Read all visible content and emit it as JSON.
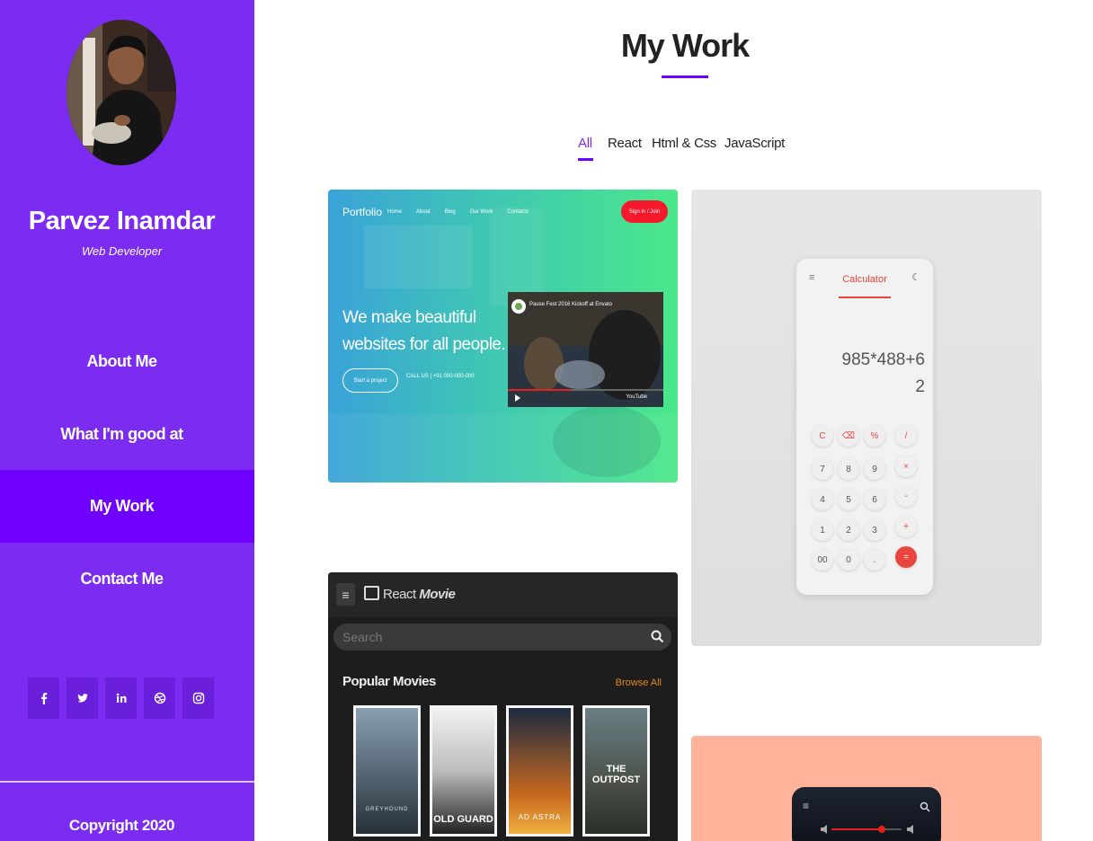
{
  "sidebar": {
    "name": "Parvez Inamdar",
    "role": "Web Developer",
    "nav": [
      {
        "label": "About Me",
        "active": false
      },
      {
        "label": "What I'm good at",
        "active": false
      },
      {
        "label": "My Work",
        "active": true
      },
      {
        "label": "Contact Me",
        "active": false
      }
    ],
    "socials": [
      "facebook-icon",
      "twitter-icon",
      "linkedin-icon",
      "dribbble-icon",
      "instagram-icon"
    ],
    "copyright": "Copyright 2020"
  },
  "main": {
    "title": "My Work",
    "filters": [
      {
        "label": "All",
        "active": true
      },
      {
        "label": "React",
        "active": false
      },
      {
        "label": "Html & Css",
        "active": false
      },
      {
        "label": "JavaScript",
        "active": false
      }
    ]
  },
  "projects": {
    "portfolio": {
      "logo": "Portfolio",
      "menu": [
        "Home",
        "About",
        "Blog",
        "Our Work",
        "Contacts"
      ],
      "sign": "Sign in / Join",
      "headline": "We make beautiful websites for all people.",
      "cta": "Start a project",
      "call": "CALL US | +91 000-000-000",
      "video_title": "Pause Fest 2016 Kickoff at Envato",
      "video_brand": "YouTube"
    },
    "calculator": {
      "title": "Calculator",
      "expression": "985*488+62",
      "keys": [
        [
          "C",
          "⌫",
          "%",
          "/"
        ],
        [
          "7",
          "8",
          "9",
          "×"
        ],
        [
          "4",
          "5",
          "6",
          "-"
        ],
        [
          "1",
          "2",
          "3",
          "+"
        ],
        [
          "00",
          "0",
          ".",
          "="
        ]
      ]
    },
    "movies": {
      "logo_main": "React",
      "logo_accent": "Movie",
      "search_placeholder": "Search",
      "section": "Popular Movies",
      "browse": "Browse All",
      "posters": [
        "GREYHOUND",
        "OLD GUARD",
        "AD ASTRA",
        "THE OUTPOST"
      ]
    }
  },
  "colors": {
    "sidebar": "#7b2cf0",
    "sidebar_active": "#6f00ff",
    "accent": "#6f00ff",
    "calc_red": "#e8453c"
  }
}
